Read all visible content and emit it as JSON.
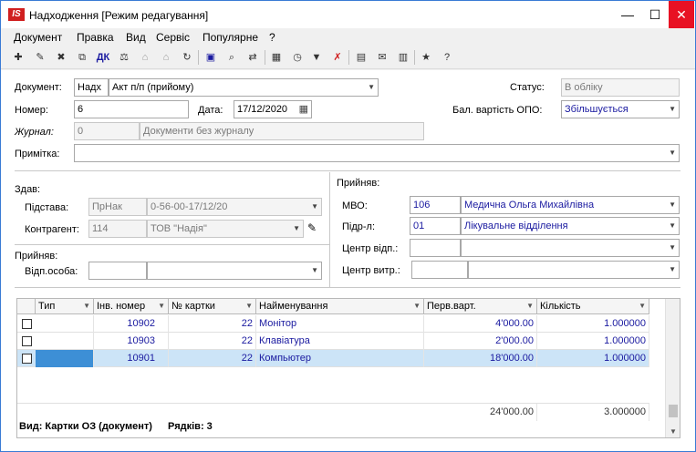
{
  "window": {
    "logo": "IS",
    "title": "Надходження [Режим редагування]",
    "minimize": "—",
    "maximize": "☐",
    "close": "✕"
  },
  "menu": [
    "Документ",
    "Правка",
    "Вид",
    "Сервіс",
    "Популярне",
    "?"
  ],
  "toolbar_icons": [
    "new-icon",
    "open-icon",
    "delete-icon",
    "copy-icon",
    "text-icon",
    "balance-icon",
    "bank-icon",
    "bank-alt-icon",
    "bank-down-icon",
    "refresh-icon",
    "save-icon",
    "search-icon",
    "find-replace-icon",
    "table-icon",
    "clock-icon",
    "filter-icon",
    "clear-filter-icon",
    "document-icon",
    "mail-icon",
    "barcode-icon",
    "star-icon",
    "help-icon"
  ],
  "header": {
    "document_label": "Документ:",
    "document_code": "Надх",
    "document_type": "Акт п/п (прийому)",
    "status_label": "Статус:",
    "status_value": "В обліку",
    "number_label": "Номер:",
    "number_value": "6",
    "date_label": "Дата:",
    "date_value": "17/12/2020",
    "balance_label": "Бал. вартість ОПО:",
    "balance_value": "Збільшується",
    "journal_label": "Журнал:",
    "journal_code": "0",
    "journal_name": "Документи без журналу",
    "note_label": "Примітка:",
    "note_value": ""
  },
  "left": {
    "gave_title": "Здав:",
    "basis_label": "Підстава:",
    "basis_code": "ПрНак",
    "basis_value": "0-56-00-17/12/20",
    "contractor_label": "Контрагент:",
    "contractor_code": "114",
    "contractor_name": "ТОВ \"Надія\"",
    "received_title": "Прийняв:",
    "person_label": "Відп.особа:",
    "person_code": "",
    "person_name": ""
  },
  "right": {
    "received_title": "Прийняв:",
    "mvo_label": "МВО:",
    "mvo_code": "106",
    "mvo_name": "Медична Ольга Михайлівна",
    "dept_label": "Підр-л:",
    "dept_code": "01",
    "dept_name": "Лікувальне відділення",
    "resp_center_label": "Центр відп.:",
    "cost_center_label": "Центр витр.:"
  },
  "grid": {
    "columns": [
      "Тип",
      "Інв. номер",
      "№ картки",
      "Найменування",
      "Перв.варт.",
      "Кількість"
    ],
    "rows": [
      {
        "type": "",
        "inv": "10902",
        "card": "22",
        "name": "Монітор",
        "cost": "4'000.00",
        "qty": "1.000000"
      },
      {
        "type": "",
        "inv": "10903",
        "card": "22",
        "name": "Клавіатура",
        "cost": "2'000.00",
        "qty": "1.000000"
      },
      {
        "type": "",
        "inv": "10901",
        "card": "22",
        "name": "Компьютер",
        "cost": "18'000.00",
        "qty": "1.000000"
      }
    ],
    "total_cost": "24'000.00",
    "total_qty": "3.000000"
  },
  "footer": {
    "view": "Вид: Картки ОЗ (документ)",
    "rows": "Рядків: 3"
  }
}
